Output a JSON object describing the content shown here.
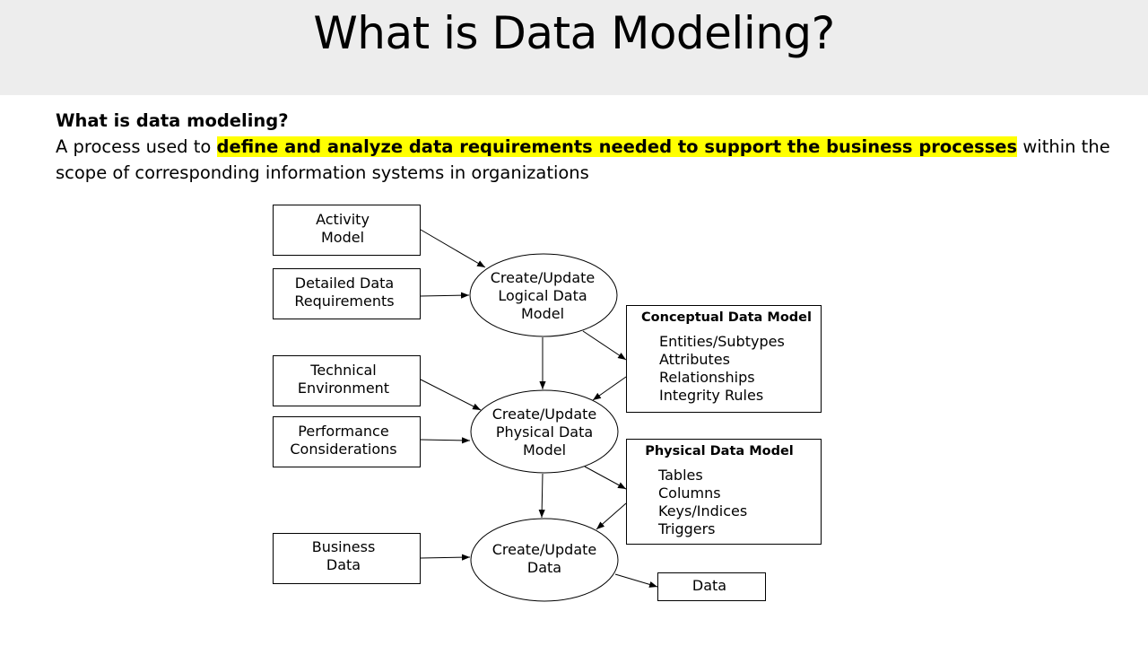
{
  "slide": {
    "title": "What is Data Modeling?"
  },
  "intro": {
    "question": "What is data modeling?",
    "text_before": "A process used to ",
    "highlight": "define and analyze data requirements needed to support the business processes",
    "text_after": " within the scope of corresponding information systems in organizations",
    "highlight_color": "#ffff00"
  },
  "diagram": {
    "inputs": {
      "activity_model": [
        "Activity",
        "Model"
      ],
      "detailed_data_requirements": [
        "Detailed Data",
        "Requirements"
      ],
      "technical_environment": [
        "Technical",
        "Environment"
      ],
      "performance_considerations": [
        "Performance",
        "Considerations"
      ],
      "business_data": [
        "Business",
        "Data"
      ]
    },
    "processes": {
      "logical": [
        "Create/Update",
        "Logical Data",
        "Model"
      ],
      "physical": [
        "Create/Update",
        "Physical Data",
        "Model"
      ],
      "data": [
        "Create/Update",
        "Data"
      ]
    },
    "conceptual_model": {
      "title": "Conceptual Data Model",
      "items": [
        "Entities/Subtypes",
        "Attributes",
        "Relationships",
        "Integrity Rules"
      ]
    },
    "physical_model": {
      "title": "Physical Data Model",
      "items": [
        "Tables",
        "Columns",
        "Keys/Indices",
        "Triggers"
      ]
    },
    "output": {
      "label": "Data"
    }
  }
}
